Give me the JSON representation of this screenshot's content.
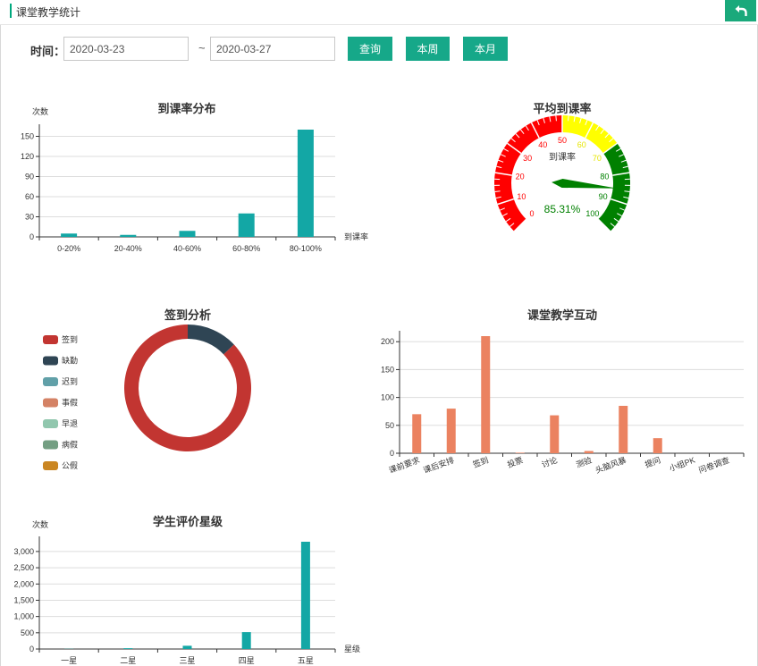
{
  "header": {
    "title": "课堂教学统计"
  },
  "filter": {
    "label": "时间：",
    "start_date": "2020-03-23",
    "separator": "~",
    "end_date": "2020-03-27",
    "query_label": "查询",
    "this_week_label": "本周",
    "this_month_label": "本月"
  },
  "colors": {
    "brand": "#16a889",
    "teal": "#13a7a5",
    "orange": "#eb8260"
  },
  "chart_data": [
    {
      "type": "bar",
      "title": "到课率分布",
      "ylabel": "次数",
      "xlabel": "到课率",
      "categories": [
        "0-20%",
        "20-40%",
        "40-60%",
        "60-80%",
        "80-100%"
      ],
      "values": [
        5,
        3,
        9,
        35,
        160
      ],
      "ylim": [
        0,
        160
      ],
      "yticks": [
        "0",
        "30",
        "60",
        "90",
        "120",
        "150"
      ],
      "grid": true,
      "color": "#13a7a5"
    },
    {
      "type": "gauge",
      "title": "平均到课率",
      "axis_label": "到课率",
      "value": 85.31,
      "value_label": "85.31%",
      "range": [
        0,
        100
      ],
      "tick_labels": [
        "0",
        "10",
        "20",
        "30",
        "40",
        "50",
        "60",
        "70",
        "80",
        "90",
        "100"
      ],
      "bands": [
        {
          "to": 50,
          "color": "#ff0000"
        },
        {
          "to": 70,
          "color": "#ffff00"
        },
        {
          "to": 100,
          "color": "#008000"
        }
      ]
    },
    {
      "type": "pie",
      "title": "签到分析",
      "legend_position": "left",
      "series": [
        {
          "name": "签到",
          "value": 87,
          "color": "#c23531"
        },
        {
          "name": "缺勤",
          "value": 13,
          "color": "#2f4554"
        },
        {
          "name": "迟到",
          "value": 0,
          "color": "#61a0a8"
        },
        {
          "name": "事假",
          "value": 0,
          "color": "#d48265"
        },
        {
          "name": "早退",
          "value": 0,
          "color": "#91c7ae"
        },
        {
          "name": "病假",
          "value": 0,
          "color": "#749f83"
        },
        {
          "name": "公假",
          "value": 0,
          "color": "#ca8622"
        }
      ]
    },
    {
      "type": "bar",
      "title": "课堂教学互动",
      "categories": [
        "课前要求",
        "课后安排",
        "签到",
        "投票",
        "讨论",
        "测验",
        "头脑风暴",
        "提问",
        "小组PK",
        "问卷调查"
      ],
      "values": [
        70,
        80,
        210,
        1,
        68,
        4,
        85,
        27,
        0,
        0
      ],
      "ylim": [
        0,
        210
      ],
      "yticks": [
        "0",
        "50",
        "100",
        "150",
        "200"
      ],
      "grid": true,
      "color": "#eb8260"
    },
    {
      "type": "bar",
      "title": "学生评价星级",
      "ylabel": "次数",
      "xlabel": "星级",
      "categories": [
        "一星",
        "二星",
        "三星",
        "四星",
        "五星"
      ],
      "values": [
        5,
        25,
        100,
        520,
        3300
      ],
      "ylim": [
        0,
        3300
      ],
      "yticks": [
        "0",
        "500",
        "1,000",
        "1,500",
        "2,000",
        "2,500",
        "3,000"
      ],
      "grid": true,
      "color": "#13a7a5"
    }
  ]
}
